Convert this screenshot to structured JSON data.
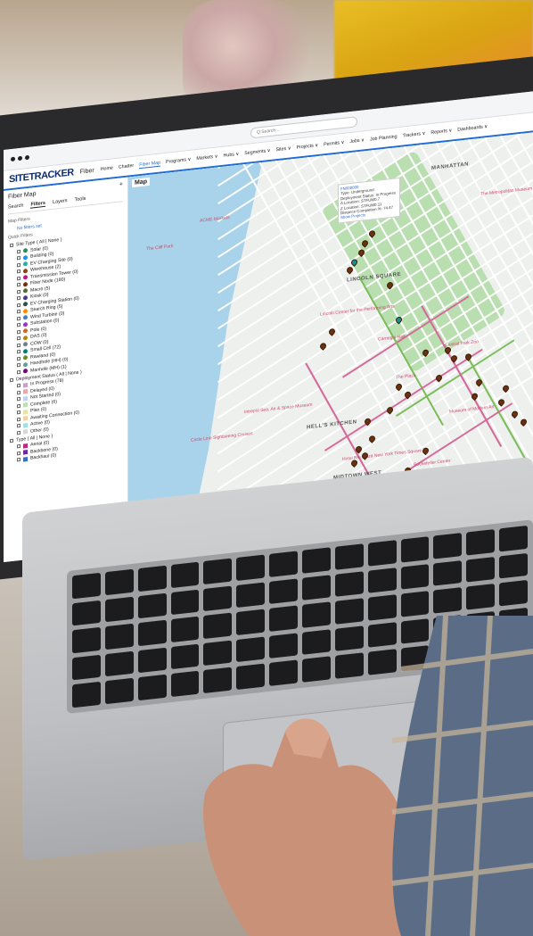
{
  "app": {
    "search_placeholder": "Q Search...",
    "logo": "SITETRACKER",
    "app_name": "Fiber",
    "nav": [
      "Home",
      "Chatter",
      "Fiber Map",
      "Programs ∨",
      "Markets ∨",
      "Hubs ∨",
      "Segments ∨",
      "Sites ∨",
      "Projects ∨",
      "Permits ∨",
      "Jobs ∨",
      "Job Planning",
      "Trackers ∨",
      "Reports ∨",
      "Dashboards ∨"
    ],
    "active_nav": "Fiber Map"
  },
  "panel": {
    "title": "Fiber Map",
    "tabs": [
      "Search",
      "Filters",
      "Layers",
      "Tools"
    ],
    "active_tab": "Filters",
    "map_filters_label": "Map Filters",
    "no_filters_label": "No filters set",
    "quick_filters_label": "Quick Filters",
    "site_type_label": "Site Type ( All | None )",
    "site_types": [
      {
        "label": "Solar (0)",
        "color": "#2e8b57"
      },
      {
        "label": "Building (0)",
        "color": "#1e90ff"
      },
      {
        "label": "EV Charging Site (0)",
        "color": "#20b2aa"
      },
      {
        "label": "Warehouse (2)",
        "color": "#8b4513"
      },
      {
        "label": "Transmission Tower (0)",
        "color": "#c71585"
      },
      {
        "label": "Fiber Node (180)",
        "color": "#7a2f0a"
      },
      {
        "label": "Macro (5)",
        "color": "#556b2f"
      },
      {
        "label": "Kiosk (0)",
        "color": "#483d8b"
      },
      {
        "label": "EV Charging Station (0)",
        "color": "#2f4f4f"
      },
      {
        "label": "Search Ring (5)",
        "color": "#ff8c00"
      },
      {
        "label": "Wind Turbine (0)",
        "color": "#4682b4"
      },
      {
        "label": "Substation (0)",
        "color": "#9932cc"
      },
      {
        "label": "Pole (0)",
        "color": "#d2691e"
      },
      {
        "label": "DAS (0)",
        "color": "#b8860b"
      },
      {
        "label": "COW (0)",
        "color": "#708090"
      },
      {
        "label": "Small Cell (72)",
        "color": "#008080"
      },
      {
        "label": "Rawland (0)",
        "color": "#6b8e23"
      },
      {
        "label": "Handhole (HH) (0)",
        "color": "#5f9ea0"
      },
      {
        "label": "Manhole (MH) (1)",
        "color": "#800080"
      }
    ],
    "deploy_status_label": "Deployment Status ( All | None )",
    "deploy_statuses": [
      {
        "label": "In Progress (78)",
        "color": "#c8a2c8"
      },
      {
        "label": "Delayed (0)",
        "color": "#e6a8a8"
      },
      {
        "label": "Not Started (0)",
        "color": "#bcd3f2"
      },
      {
        "label": "Complete (6)",
        "color": "#b8e2b0"
      },
      {
        "label": "Plan (0)",
        "color": "#e6e6a0"
      },
      {
        "label": "Awaiting Connection (0)",
        "color": "#f5d0a0"
      },
      {
        "label": "Active (0)",
        "color": "#a0e0e0"
      },
      {
        "label": "Other (0)",
        "color": "#d8d8d8"
      }
    ],
    "type_label": "Type ( All | None )",
    "types": [
      {
        "label": "Aerial (0)",
        "color": "#c0267b"
      },
      {
        "label": "Backbone (0)",
        "color": "#6a2ca0"
      },
      {
        "label": "Backhaul (0)",
        "color": "#3b6fc4"
      }
    ]
  },
  "map": {
    "header": "Map",
    "labels": [
      "MANHATTAN",
      "LINCOLN SQUARE",
      "HELL'S KITCHEN",
      "MIDTOWN WEST"
    ],
    "pois": [
      "The Metropolitan Museum of Art",
      "Central Park Zoo",
      "The Plaza",
      "Circle Line Sightseeing Cruises",
      "Intrepid Sea, Air & Space Museum",
      "Lincoln Center for the Performing Arts",
      "Museum of Modern Art",
      "Rockefeller Center",
      "Hotel Riu Plaza New York Times Square",
      "ACME Markets",
      "The Cliff Park",
      "Carnegie Hall"
    ],
    "tooltip": {
      "id": "FN000000",
      "lines": [
        "Type: Underground",
        "Deployment Status: In Progress",
        "A Location: STFUM0.7",
        "Z Location: STFUM0.11",
        "Distance Completion %: 74.47"
      ],
      "link": "Show Projects"
    }
  },
  "colors": {
    "brand": "#0d2f6e",
    "accent": "#1f6bd4",
    "route_pink": "#d56a9a",
    "route_green": "#7bbd5a",
    "pin": "#6b3210"
  }
}
